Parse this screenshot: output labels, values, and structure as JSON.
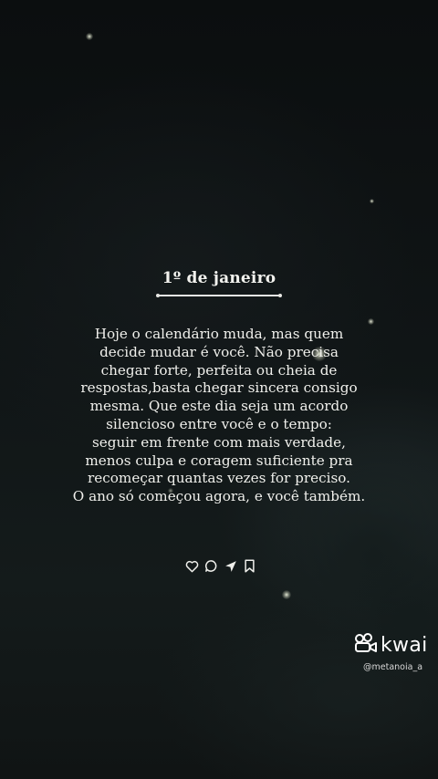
{
  "post": {
    "title": "1º de janeiro",
    "body_lines": [
      "Hoje o calendário muda, mas quem",
      "decide mudar é você. Não precisa",
      "chegar forte, perfeita ou cheia de",
      "respostas,basta chegar sincera consigo",
      "mesma. Que este dia seja um acordo",
      "silencioso entre você e o tempo:",
      "seguir em frente com mais verdade,",
      "menos culpa e coragem suficiente pra",
      "recomeçar quantas vezes for preciso.",
      "O ano só começou agora, e você também."
    ]
  },
  "actions": {
    "icons": [
      "heart-icon",
      "comment-icon",
      "share-icon",
      "bookmark-icon"
    ]
  },
  "watermark": {
    "brand": "kwai",
    "handle": "@metanoia_a"
  },
  "colors": {
    "background": "#0e1112",
    "text": "#f0f0ec"
  }
}
